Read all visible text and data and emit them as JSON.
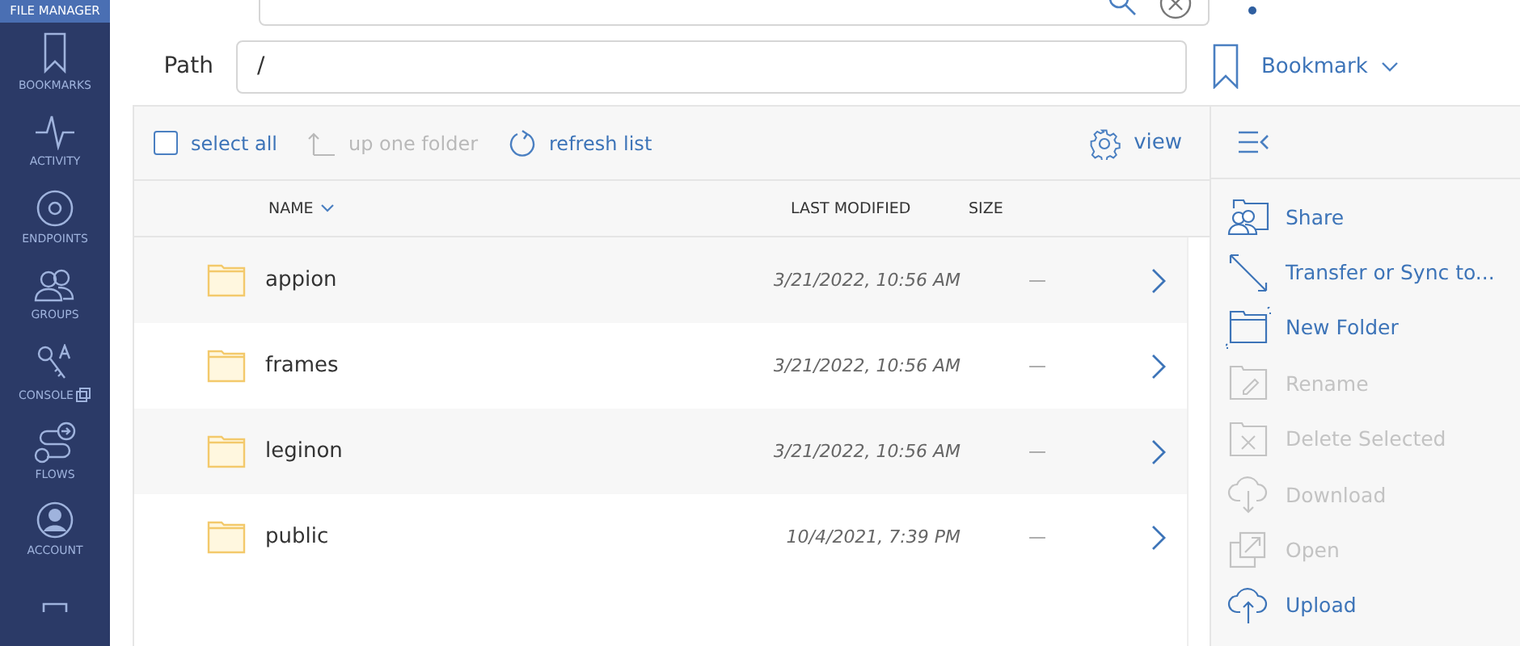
{
  "sidebar": {
    "items": [
      {
        "kind": "file-manager",
        "label": "FILE MANAGER",
        "selected": true
      },
      {
        "kind": "bookmark",
        "label": "BOOKMARKS",
        "selected": false
      },
      {
        "kind": "activity",
        "label": "ACTIVITY",
        "selected": false
      },
      {
        "kind": "endpoints",
        "label": "ENDPOINTS",
        "selected": false
      },
      {
        "kind": "groups",
        "label": "GROUPS",
        "selected": false
      },
      {
        "kind": "console",
        "label": "CONSOLE",
        "selected": false
      },
      {
        "kind": "flows",
        "label": "FLOWS",
        "selected": false
      },
      {
        "kind": "account",
        "label": "ACCOUNT",
        "selected": false
      },
      {
        "kind": "partial",
        "selected": false
      }
    ]
  },
  "path": {
    "label": "Path",
    "value": "/"
  },
  "bookmark": {
    "label": "Bookmark"
  },
  "toolbar": {
    "select_all": {
      "label": "select all",
      "checked": false
    },
    "up_one_folder": {
      "label": "up one folder",
      "disabled": true
    },
    "refresh": {
      "label": "refresh list"
    },
    "view": {
      "label": "view"
    }
  },
  "table": {
    "columns": [
      {
        "label": "NAME",
        "sorted": true
      },
      {
        "label": "LAST MODIFIED",
        "sorted": false
      },
      {
        "label": "SIZE",
        "sorted": false
      }
    ],
    "rows": [
      {
        "name": "appion",
        "modified": "3/21/2022, 10:56 AM",
        "size": "—"
      },
      {
        "name": "frames",
        "modified": "3/21/2022, 10:56 AM",
        "size": "—"
      },
      {
        "name": "leginon",
        "modified": "3/21/2022, 10:56 AM",
        "size": "—"
      },
      {
        "name": "public",
        "modified": "10/4/2021, 7:39 PM",
        "size": "—"
      }
    ]
  },
  "actions": [
    {
      "kind": "share",
      "label": "Share",
      "disabled": false
    },
    {
      "kind": "transfer",
      "label": "Transfer or Sync to...",
      "disabled": false
    },
    {
      "kind": "new-folder",
      "label": "New Folder",
      "disabled": false
    },
    {
      "kind": "rename",
      "label": "Rename",
      "disabled": true
    },
    {
      "kind": "delete",
      "label": "Delete Selected",
      "disabled": true
    },
    {
      "kind": "download",
      "label": "Download",
      "disabled": true
    },
    {
      "kind": "open",
      "label": "Open",
      "disabled": true
    },
    {
      "kind": "upload",
      "label": "Upload",
      "disabled": false
    }
  ]
}
